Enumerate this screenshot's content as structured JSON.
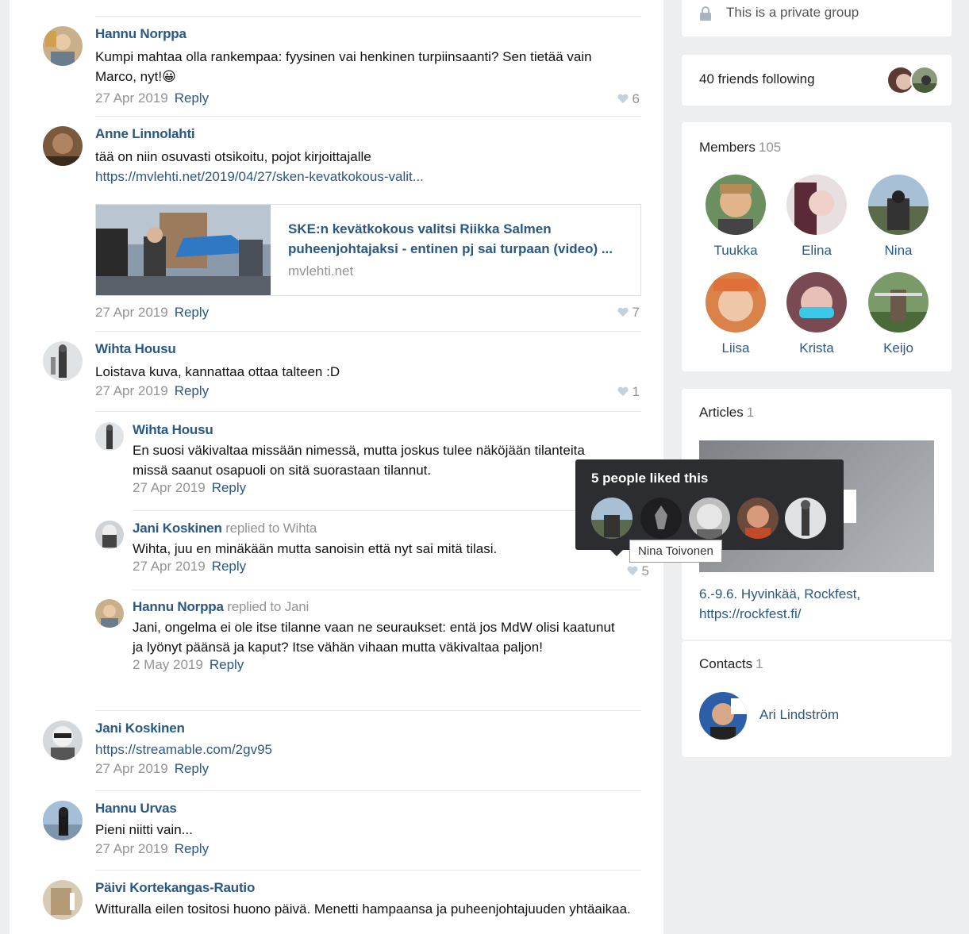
{
  "comments": [
    {
      "author": "Hannu Norppa",
      "text": "Kumpi mahtaa olla rankempaa: fyysinen vai henkinen turpiinsaanti? Sen tietää vain Marco, nyt!",
      "emoji": "😀",
      "date": "27 Apr 2019",
      "reply": "Reply",
      "likes": "6"
    },
    {
      "author": "Anne Linnolahti",
      "text": "tää on niin osuvasti otsikoitu, pojot kirjoittajalle",
      "link": "https://mvlehti.net/2019/04/27/sken-kevatkokous-valit...",
      "date": "27 Apr 2019",
      "reply": "Reply",
      "likes": "7",
      "card": {
        "title": "SKE:n kevätkokous valitsi Riikka Salmen puheenjohtajaksi - entinen pj sai turpaan (video) ...",
        "domain": "mvlehti.net"
      }
    },
    {
      "author": "Wihta Housu",
      "text": "Loistava kuva, kannattaa ottaa talteen :D",
      "date": "27 Apr 2019",
      "reply": "Reply",
      "likes": "1"
    },
    {
      "author": "Wihta Housu",
      "text": "En suosi väkivaltaa missään nimessä, mutta joskus tulee näköjään tilanteita missä saanut osapuoli on sitä suorastaan tilannut.",
      "date": "27 Apr 2019",
      "reply": "Reply"
    },
    {
      "author": "Jani Koskinen",
      "replied_to": "replied to Wihta",
      "text": "Wihta, juu en minäkään mutta sanoisin että nyt sai mitä tilasi.",
      "date": "27 Apr 2019",
      "reply": "Reply",
      "likes": "5"
    },
    {
      "author": "Hannu Norppa",
      "replied_to": "replied to Jani",
      "text": "Jani, ongelma ei ole itse tilanne vaan ne seuraukset: entä jos MdW olisi kaatunut ja lyönyt päänsä ja kaput? Itse vähän vihaan mutta väkivaltaa paljon!",
      "date": "2 May 2019",
      "reply": "Reply"
    },
    {
      "author": "Jani Koskinen",
      "link": "https://streamable.com/2gv95",
      "date": "27 Apr 2019",
      "reply": "Reply"
    },
    {
      "author": "Hannu Urvas",
      "text": "Pieni niitti vain...",
      "date": "27 Apr 2019",
      "reply": "Reply"
    },
    {
      "author": "Päivi Kortekangas-Rautio",
      "text": "Witturalla eilen tositosi huono päivä. Menetti hampaansa ja puheenjohtajuuden yhtäaikaa."
    }
  ],
  "tooltip": {
    "title": "5 people liked this",
    "hover_name": "Nina Toivonen"
  },
  "sidebar": {
    "private": "This is a private group",
    "friends": "40 friends following",
    "members": {
      "title": "Members",
      "count": "105",
      "names": [
        "Tuukka",
        "Elina",
        "Nina",
        "Liisa",
        "Krista",
        "Keijo"
      ]
    },
    "articles": {
      "title": "Articles",
      "count": "1",
      "text": "6.-9.6. Hyvinkää, Rockfest, https://rockfest.fi/"
    },
    "contacts": {
      "title": "Contacts",
      "count": "1",
      "name": "Ari Lindström"
    }
  },
  "colors": {
    "link": "#2a5885",
    "muted": "#939393",
    "bg": "#edeef0"
  }
}
